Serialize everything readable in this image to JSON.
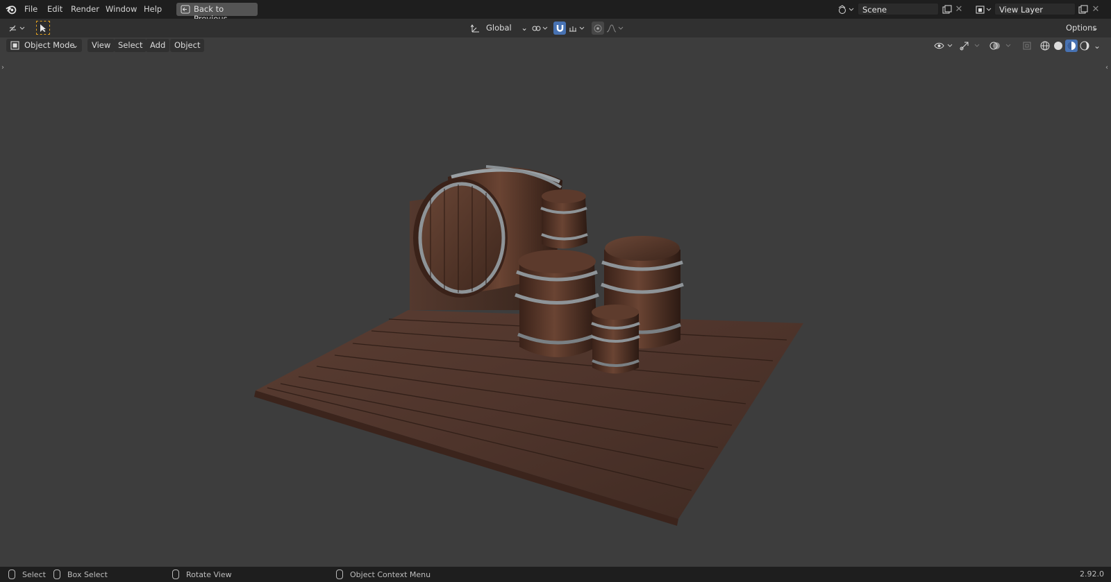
{
  "topbar": {
    "menus": [
      "File",
      "Edit",
      "Render",
      "Window",
      "Help"
    ],
    "back_button": "Back to Previous",
    "scene_field": "Scene",
    "view_layer_field": "View Layer"
  },
  "tool_header": {
    "orientation": "Global",
    "options": "Options"
  },
  "viewport_header": {
    "mode": "Object Mode",
    "menus": [
      "View",
      "Select",
      "Add",
      "Object"
    ]
  },
  "statusbar": {
    "select": "Select",
    "box_select": "Box Select",
    "rotate_view": "Rotate View",
    "context_menu": "Object Context Menu",
    "version": "2.92.0"
  },
  "colors": {
    "accent": "#4772b3",
    "background": "#3d3d3d",
    "header": "#303030",
    "topbar": "#1e1e1e"
  }
}
